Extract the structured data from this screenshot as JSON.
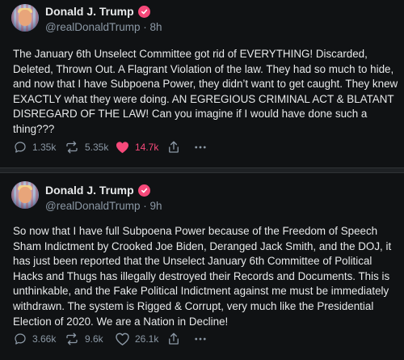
{
  "posts": [
    {
      "author": {
        "name": "Donald J. Trump",
        "handle": "@realDonaldTrump",
        "time": "8h",
        "separator": "·"
      },
      "text": "The January 6th Unselect Committee got rid of EVERYTHING! Discarded, Deleted, Thrown Out. A Flagrant Violation of the law. They had so much to hide, and now that I have Subpoena Power, they didn’t want to get caught. They knew EXACTLY what they were doing. AN EGREGIOUS CRIMINAL ACT & BLATANT DISREGARD OF THE LAW! Can you imagine if I would have done such a thing???",
      "stats": {
        "replies": "1.35k",
        "reposts": "5.35k",
        "likes": "14.7k"
      },
      "liked": true
    },
    {
      "author": {
        "name": "Donald J. Trump",
        "handle": "@realDonaldTrump",
        "time": "9h",
        "separator": "·"
      },
      "text": "So now that I have full Subpoena Power because of the Freedom of Speech Sham Indictment by Crooked Joe Biden,  Deranged Jack Smith, and the DOJ, it has just been reported that the Unselect January 6th Committee of Political Hacks and Thugs has illegally destroyed their Records and Documents. This is unthinkable, and the Fake Political Indictment against me must be immediately withdrawn. The system is Rigged & Corrupt, very much like the Presidential Election of 2020. We are a Nation in Decline!",
      "stats": {
        "replies": "3.66k",
        "reposts": "9.6k",
        "likes": "26.1k"
      },
      "liked": false
    }
  ],
  "icons": {
    "verified": "verified-badge-icon",
    "reply": "reply-icon",
    "repost": "repost-icon",
    "like": "heart-icon",
    "share": "share-icon",
    "more": "more-icon"
  },
  "colors": {
    "background": "#101214",
    "accent": "#f6497a",
    "muted": "#8b98a5",
    "text": "#e7e9ea"
  }
}
